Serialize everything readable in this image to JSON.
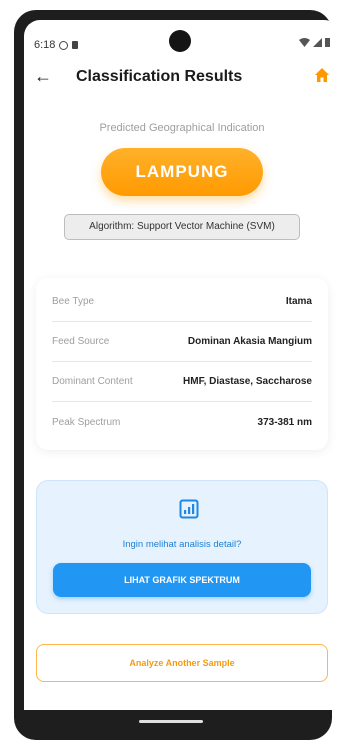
{
  "status_bar": {
    "time": "6:18",
    "icons": [
      "settings-dot-icon",
      "sim-icon",
      "wifi-icon",
      "signal-icon",
      "battery-icon"
    ]
  },
  "header": {
    "title": "Classification Results",
    "back_icon": "back-arrow-icon",
    "home_icon": "home-icon",
    "home_color": "#ff9800"
  },
  "result": {
    "subtitle": "Predicted Geographical Indication",
    "value": "LAMPUNG",
    "algorithm": "Algorithm: Support Vector Machine (SVM)",
    "accent": "#ff9800"
  },
  "details": [
    {
      "label": "Bee Type",
      "value": "Itama"
    },
    {
      "label": "Feed Source",
      "value": "Dominan Akasia Mangium"
    },
    {
      "label": "Dominant Content",
      "value": "HMF, Diastase, Saccharose"
    },
    {
      "label": "Peak Spectrum",
      "value": "373-381 nm"
    }
  ],
  "analysis": {
    "prompt": "Ingin melihat analisis detail?",
    "button_label": "LIHAT GRAFIK SPEKTRUM",
    "icon": "bar-chart-icon",
    "color": "#2196f3"
  },
  "actions": {
    "analyze_label": "Analyze Another Sample"
  }
}
